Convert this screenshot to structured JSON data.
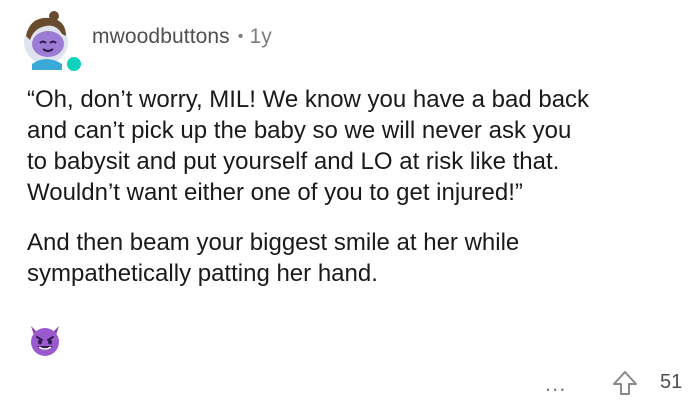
{
  "comment": {
    "username": "mwoodbuttons",
    "separator": "•",
    "age": "1y",
    "paragraphs": [
      "“Oh, don’t worry, MIL! We know you have a bad back\nand can’t pick up the baby so we will never ask you\nto babysit and put yourself and LO at risk like that.\nWouldn’t want either one of you to get injured!”",
      "And then beam your biggest smile at her while\nsympathetically patting her hand."
    ],
    "emoji": "smiling-imp-emoji",
    "more_label": "...",
    "score": "51"
  },
  "colors": {
    "username": "#4f4f4f",
    "meta": "#7c7c7c",
    "body": "#1a1a1b",
    "online": "#0dd3bb",
    "emoji_purple": "#9b59d0"
  }
}
